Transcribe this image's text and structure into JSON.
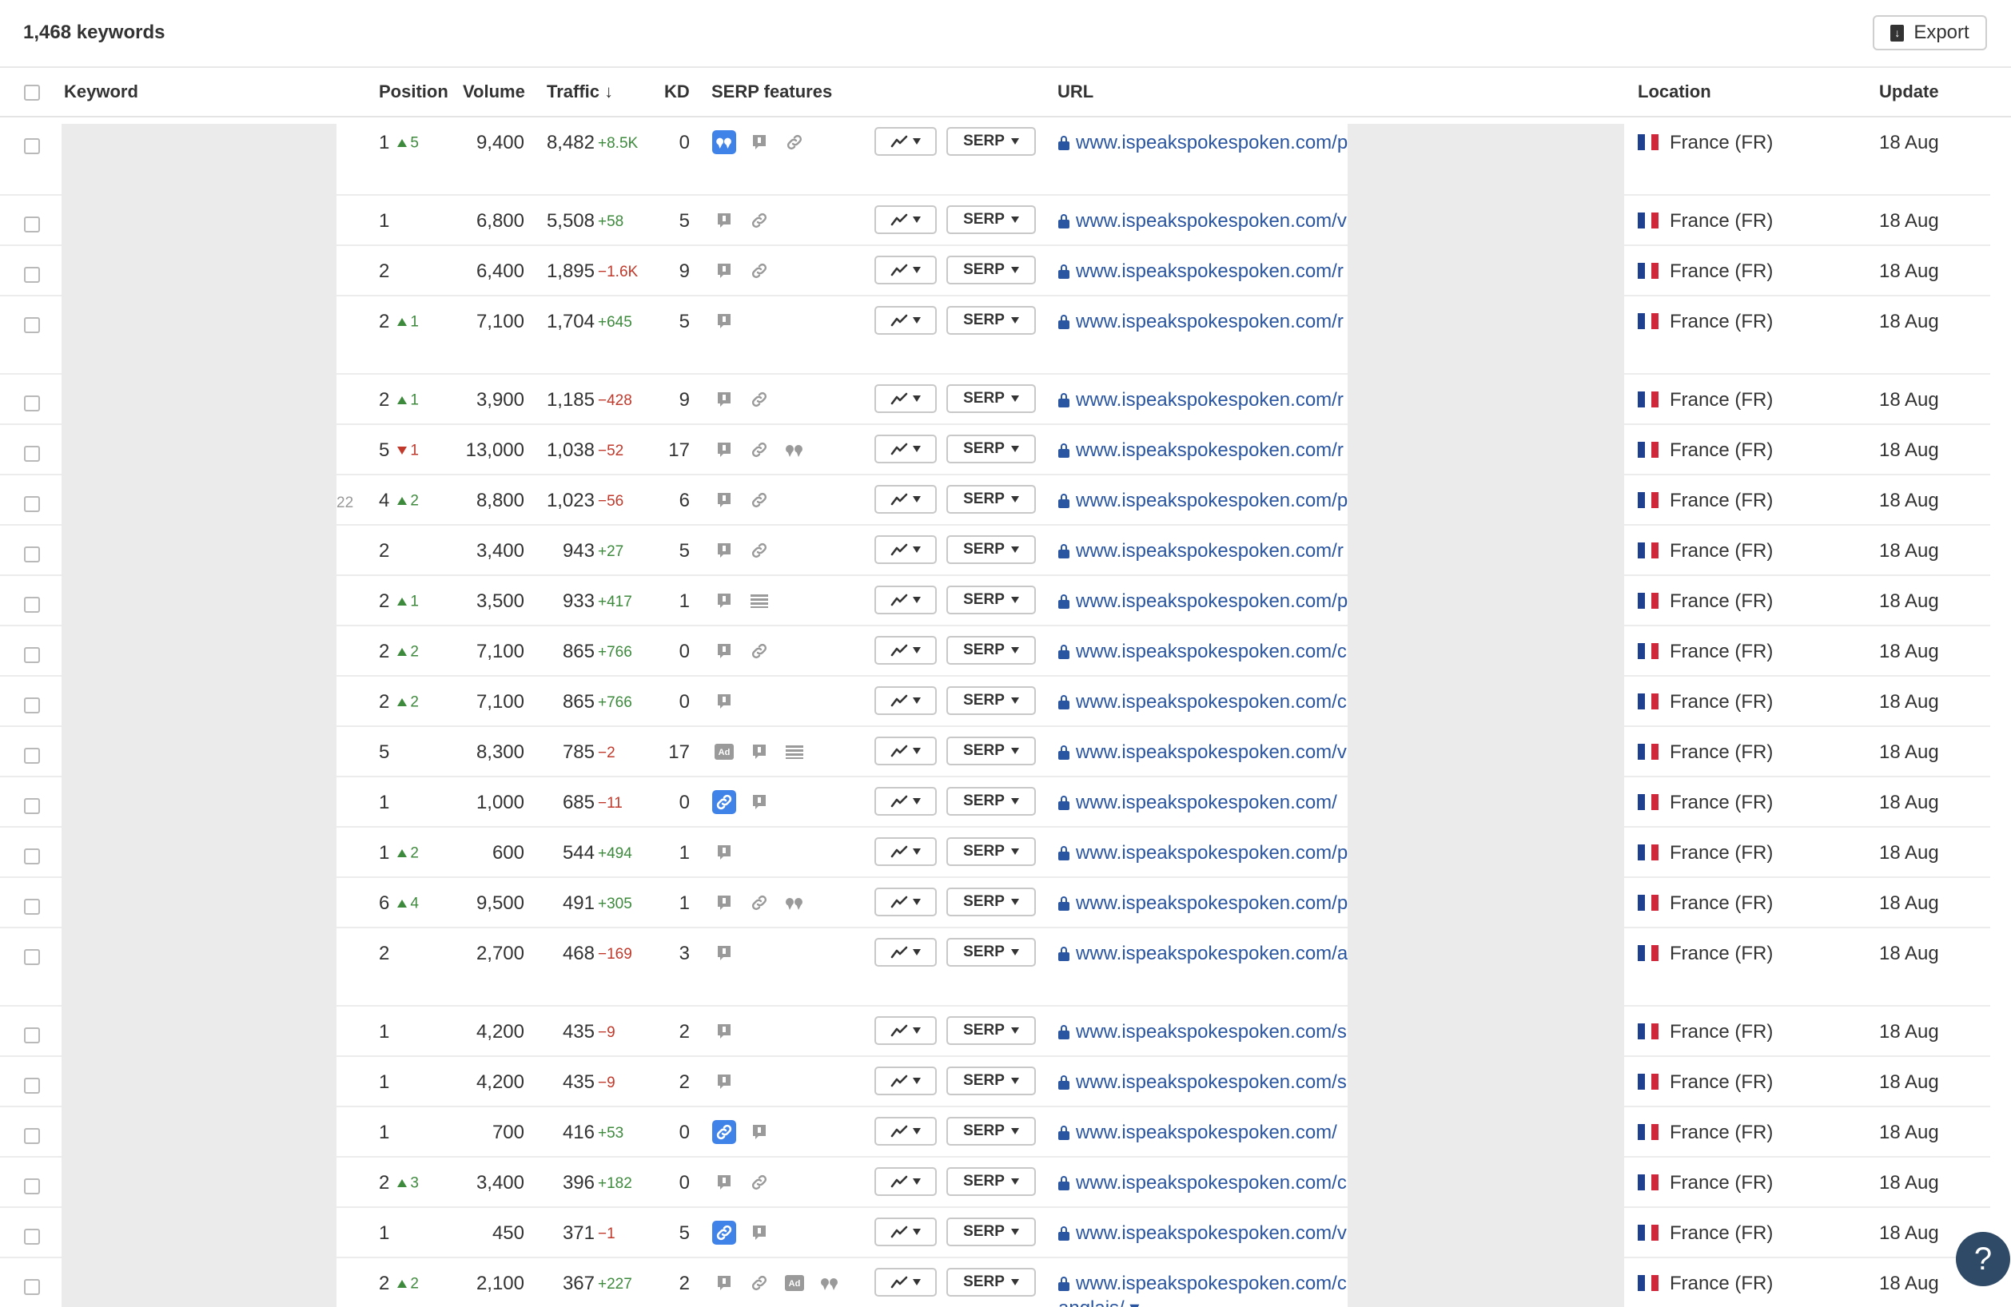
{
  "header": {
    "keyword_count": "1,468 keywords",
    "export_label": "Export"
  },
  "columns": {
    "keyword": "Keyword",
    "position": "Position",
    "volume": "Volume",
    "traffic": "Traffic ↓",
    "kd": "KD",
    "serp_features": "SERP features",
    "url": "URL",
    "location": "Location",
    "update": "Update"
  },
  "serp_button_label": "SERP",
  "colors": {
    "link": "#2a55a0",
    "positive": "#3d8a3d",
    "negative": "#c0392b",
    "feature_active": "#3f82e8",
    "flag_blue": "#1f3f8f",
    "flag_red": "#d0283a"
  },
  "rows": [
    {
      "kw": "",
      "pos": "1",
      "pos_dir": "up",
      "pos_chg": "5",
      "vol": "9,400",
      "traffic": "8,482",
      "t_chg": "+8.5K",
      "t_dir": "up",
      "kd": "0",
      "features": [
        "quote-active",
        "snippet",
        "link"
      ],
      "url": "www.ispeakspokespoken.com/p",
      "loc": "France (FR)",
      "upd": "18 Aug",
      "tall": true
    },
    {
      "kw": "",
      "pos": "1",
      "pos_dir": "",
      "pos_chg": "",
      "vol": "6,800",
      "traffic": "5,508",
      "t_chg": "+58",
      "t_dir": "up",
      "kd": "5",
      "features": [
        "snippet",
        "link"
      ],
      "url": "www.ispeakspokespoken.com/v",
      "loc": "France (FR)",
      "upd": "18 Aug",
      "tall": false
    },
    {
      "kw": "",
      "pos": "2",
      "pos_dir": "",
      "pos_chg": "",
      "vol": "6,400",
      "traffic": "1,895",
      "t_chg": "−1.6K",
      "t_dir": "down",
      "kd": "9",
      "features": [
        "snippet",
        "link"
      ],
      "url": "www.ispeakspokespoken.com/r",
      "loc": "France (FR)",
      "upd": "18 Aug",
      "tall": false
    },
    {
      "kw": "",
      "pos": "2",
      "pos_dir": "up",
      "pos_chg": "1",
      "vol": "7,100",
      "traffic": "1,704",
      "t_chg": "+645",
      "t_dir": "up",
      "kd": "5",
      "features": [
        "snippet"
      ],
      "url": "www.ispeakspokespoken.com/r",
      "loc": "France (FR)",
      "upd": "18 Aug",
      "tall": true
    },
    {
      "kw": "",
      "pos": "2",
      "pos_dir": "up",
      "pos_chg": "1",
      "vol": "3,900",
      "traffic": "1,185",
      "t_chg": "−428",
      "t_dir": "down",
      "kd": "9",
      "features": [
        "snippet",
        "link"
      ],
      "url": "www.ispeakspokespoken.com/r",
      "loc": "France (FR)",
      "upd": "18 Aug",
      "tall": false
    },
    {
      "kw": "",
      "pos": "5",
      "pos_dir": "down",
      "pos_chg": "1",
      "vol": "13,000",
      "traffic": "1,038",
      "t_chg": "−52",
      "t_dir": "down",
      "kd": "17",
      "features": [
        "snippet",
        "link",
        "quote"
      ],
      "url": "www.ispeakspokespoken.com/r",
      "loc": "France (FR)",
      "upd": "18 Aug",
      "tall": false
    },
    {
      "kw": "22",
      "pos": "4",
      "pos_dir": "up",
      "pos_chg": "2",
      "vol": "8,800",
      "traffic": "1,023",
      "t_chg": "−56",
      "t_dir": "down",
      "kd": "6",
      "features": [
        "snippet",
        "link"
      ],
      "url": "www.ispeakspokespoken.com/p",
      "loc": "France (FR)",
      "upd": "18 Aug",
      "tall": false
    },
    {
      "kw": "",
      "pos": "2",
      "pos_dir": "",
      "pos_chg": "",
      "vol": "3,400",
      "traffic": "943",
      "t_chg": "+27",
      "t_dir": "up",
      "kd": "5",
      "features": [
        "snippet",
        "link"
      ],
      "url": "www.ispeakspokespoken.com/r",
      "loc": "France (FR)",
      "upd": "18 Aug",
      "tall": false
    },
    {
      "kw": "",
      "pos": "2",
      "pos_dir": "up",
      "pos_chg": "1",
      "vol": "3,500",
      "traffic": "933",
      "t_chg": "+417",
      "t_dir": "up",
      "kd": "1",
      "features": [
        "snippet",
        "table"
      ],
      "url": "www.ispeakspokespoken.com/p",
      "loc": "France (FR)",
      "upd": "18 Aug",
      "tall": false
    },
    {
      "kw": "",
      "pos": "2",
      "pos_dir": "up",
      "pos_chg": "2",
      "vol": "7,100",
      "traffic": "865",
      "t_chg": "+766",
      "t_dir": "up",
      "kd": "0",
      "features": [
        "snippet",
        "link"
      ],
      "url": "www.ispeakspokespoken.com/c",
      "loc": "France (FR)",
      "upd": "18 Aug",
      "tall": false
    },
    {
      "kw": "",
      "pos": "2",
      "pos_dir": "up",
      "pos_chg": "2",
      "vol": "7,100",
      "traffic": "865",
      "t_chg": "+766",
      "t_dir": "up",
      "kd": "0",
      "features": [
        "snippet"
      ],
      "url": "www.ispeakspokespoken.com/c",
      "loc": "France (FR)",
      "upd": "18 Aug",
      "tall": false
    },
    {
      "kw": "",
      "pos": "5",
      "pos_dir": "",
      "pos_chg": "",
      "vol": "8,300",
      "traffic": "785",
      "t_chg": "−2",
      "t_dir": "down",
      "kd": "17",
      "features": [
        "ad",
        "snippet",
        "table"
      ],
      "url": "www.ispeakspokespoken.com/v",
      "loc": "France (FR)",
      "upd": "18 Aug",
      "tall": false
    },
    {
      "kw": "",
      "pos": "1",
      "pos_dir": "",
      "pos_chg": "",
      "vol": "1,000",
      "traffic": "685",
      "t_chg": "−11",
      "t_dir": "down",
      "kd": "0",
      "features": [
        "link-active",
        "snippet"
      ],
      "url": "www.ispeakspokespoken.com/",
      "loc": "France (FR)",
      "upd": "18 Aug",
      "tall": false
    },
    {
      "kw": "",
      "pos": "1",
      "pos_dir": "up",
      "pos_chg": "2",
      "vol": "600",
      "traffic": "544",
      "t_chg": "+494",
      "t_dir": "up",
      "kd": "1",
      "features": [
        "snippet"
      ],
      "url": "www.ispeakspokespoken.com/p",
      "loc": "France (FR)",
      "upd": "18 Aug",
      "tall": false
    },
    {
      "kw": "",
      "pos": "6",
      "pos_dir": "up",
      "pos_chg": "4",
      "vol": "9,500",
      "traffic": "491",
      "t_chg": "+305",
      "t_dir": "up",
      "kd": "1",
      "features": [
        "snippet",
        "link",
        "quote"
      ],
      "url": "www.ispeakspokespoken.com/p",
      "loc": "France (FR)",
      "upd": "18 Aug",
      "tall": false
    },
    {
      "kw": "",
      "pos": "2",
      "pos_dir": "",
      "pos_chg": "",
      "vol": "2,700",
      "traffic": "468",
      "t_chg": "−169",
      "t_dir": "down",
      "kd": "3",
      "features": [
        "snippet"
      ],
      "url": "www.ispeakspokespoken.com/a",
      "loc": "France (FR)",
      "upd": "18 Aug",
      "tall": true
    },
    {
      "kw": "",
      "pos": "1",
      "pos_dir": "",
      "pos_chg": "",
      "vol": "4,200",
      "traffic": "435",
      "t_chg": "−9",
      "t_dir": "down",
      "kd": "2",
      "features": [
        "snippet"
      ],
      "url": "www.ispeakspokespoken.com/s",
      "loc": "France (FR)",
      "upd": "18 Aug",
      "tall": false
    },
    {
      "kw": "",
      "pos": "1",
      "pos_dir": "",
      "pos_chg": "",
      "vol": "4,200",
      "traffic": "435",
      "t_chg": "−9",
      "t_dir": "down",
      "kd": "2",
      "features": [
        "snippet"
      ],
      "url": "www.ispeakspokespoken.com/s",
      "loc": "France (FR)",
      "upd": "18 Aug",
      "tall": false
    },
    {
      "kw": "",
      "pos": "1",
      "pos_dir": "",
      "pos_chg": "",
      "vol": "700",
      "traffic": "416",
      "t_chg": "+53",
      "t_dir": "up",
      "kd": "0",
      "features": [
        "link-active",
        "snippet"
      ],
      "url": "www.ispeakspokespoken.com/",
      "loc": "France (FR)",
      "upd": "18 Aug",
      "tall": false
    },
    {
      "kw": "",
      "pos": "2",
      "pos_dir": "up",
      "pos_chg": "3",
      "vol": "3,400",
      "traffic": "396",
      "t_chg": "+182",
      "t_dir": "up",
      "kd": "0",
      "features": [
        "snippet",
        "link"
      ],
      "url": "www.ispeakspokespoken.com/c",
      "loc": "France (FR)",
      "upd": "18 Aug",
      "tall": false
    },
    {
      "kw": "",
      "pos": "1",
      "pos_dir": "",
      "pos_chg": "",
      "vol": "450",
      "traffic": "371",
      "t_chg": "−1",
      "t_dir": "down",
      "kd": "5",
      "features": [
        "link-active",
        "snippet"
      ],
      "url": "www.ispeakspokespoken.com/v",
      "loc": "France (FR)",
      "upd": "18 Aug",
      "tall": false
    },
    {
      "kw": "",
      "pos": "2",
      "pos_dir": "up",
      "pos_chg": "2",
      "vol": "2,100",
      "traffic": "367",
      "t_chg": "+227",
      "t_dir": "up",
      "kd": "2",
      "features": [
        "snippet",
        "link",
        "ad",
        "quote"
      ],
      "url": "www.ispeakspokespoken.com/c",
      "loc": "France (FR)",
      "upd": "18 Aug",
      "tall": false,
      "tail": "anglais/ ▾"
    }
  ],
  "help_label": "?"
}
